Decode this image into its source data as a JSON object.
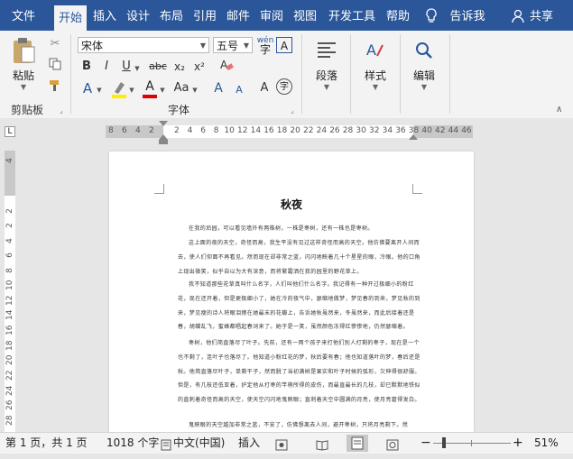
{
  "tabs": [
    "文件",
    "开始",
    "插入",
    "设计",
    "布局",
    "引用",
    "邮件",
    "审阅",
    "视图",
    "开发工具",
    "帮助",
    "告诉我",
    "共享"
  ],
  "ribbon": {
    "clipboard": {
      "paste": "粘贴",
      "label": "剪贴板"
    },
    "font": {
      "name": "宋体",
      "size": "五号",
      "wen": "wén",
      "bold": "B",
      "italic": "I",
      "underline": "U",
      "strike": "abc",
      "sub": "x₂",
      "sup": "x²",
      "label": "字体",
      "aa": "Aa",
      "a_grow": "A",
      "a_shrink": "A",
      "char_a": "A",
      "circle_char": "字"
    },
    "paragraph": {
      "label": "段落"
    },
    "styles": {
      "label": "样式"
    },
    "editing": {
      "label": "编辑"
    }
  },
  "ruler": {
    "left": [
      "8",
      "6",
      "4",
      "2"
    ],
    "right": [
      "2",
      "4",
      "6",
      "8",
      "10",
      "12",
      "14",
      "16",
      "18",
      "20",
      "22",
      "24",
      "26",
      "28",
      "30",
      "32",
      "34",
      "36",
      "38",
      "40",
      "42",
      "44",
      "46"
    ],
    "vertical": [
      "4",
      "2",
      "2",
      "4",
      "6",
      "8",
      "10",
      "12",
      "14",
      "16",
      "18",
      "20",
      "22",
      "24",
      "26",
      "28"
    ]
  },
  "document": {
    "title": "秋夜",
    "paragraphs": [
      "在我的后园，可以看见墙外有两株树，一株是枣树，还有一株也是枣树。",
      "这上面的夜的天空，奇怪而高，我生平没有见过这样奇怪而高的天空。他仿佛要离开人间而去，使人们仰面不再看见。然而现在却非常之蓝，闪闪地䀹着几十个星星的眼，冷眼。他的口角上现出微笑，似乎自以为大有深意，而将繁霜洒在我的园里的野花草上。",
      "我不知道那些花草真叫什么名字，人们叫他们什么名字。我记得有一种开过极细小的粉红花，现在还开着，但是更极细小了，她在冷的夜气中，瑟缩地做梦，梦见春的到来，梦见秋的到来，梦见瘦的诗人将眼泪擦在她最末的花瓣上，告诉她秋虽然来，冬虽然来，而此后接着还是春，胡蝶乱飞，蜜蜂都唱起春词来了。她于是一笑，虽然颜色冻得红惨惨地，仍然瑟缩着。",
      "枣树，他们简直落尽了叶子。先前，还有一两个孩子来打他们别人打剩的枣子，现在是一个也不剩了，连叶子也落尽了。他知道小粉红花的梦，秋后要有春；他也知道落叶的梦，春后还是秋。他简直落尽叶子，单剩干子，然而脱了当初满树是果实和叶子时候的弧形，欠伸得很舒服。但是，有几枝还低亚着，护定他从打枣的竿梢所得的皮伤，而最直最长的几枝，却已默默地铁似的直刺着奇怪而高的天空，使天空闪闪地鬼䀹眼；直刺着天空中圆满的月亮，使月亮窘得发白。",
      "鬼䀹眼的天空越加非常之蓝，不安了，仿佛想离去人间，避开枣树，只将月亮剩下。然"
    ]
  },
  "status": {
    "page": "第 1 页，共 1 页",
    "words": "1018 个字",
    "lang": "中文(中国)",
    "mode": "插入",
    "zoom": "51%",
    "minus": "−",
    "plus": "+"
  }
}
